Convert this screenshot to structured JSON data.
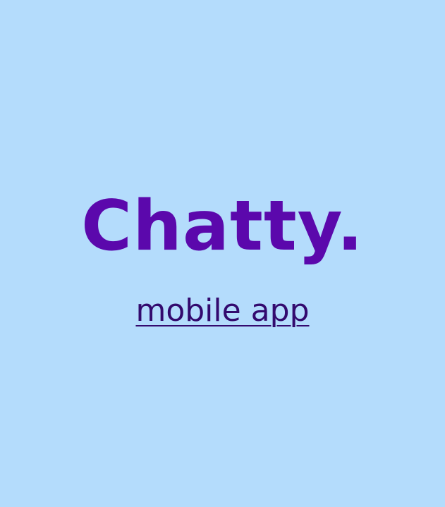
{
  "brand": {
    "name": "Chatty."
  },
  "subtitle": {
    "label": "mobile app"
  },
  "colors": {
    "background": "#b4dcfc",
    "brand": "#5b08ac",
    "link": "#330a6e"
  }
}
